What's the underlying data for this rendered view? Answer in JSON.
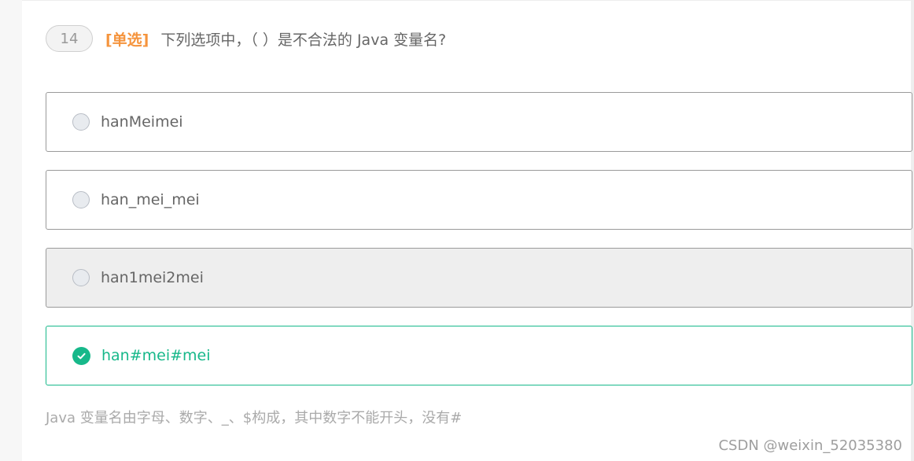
{
  "question": {
    "number": "14",
    "type": "[单选]",
    "text": "下列选项中，（ ）是不合法的 Java 变量名?"
  },
  "options": [
    {
      "label": "hanMeimei",
      "state": "unselected"
    },
    {
      "label": "han_mei_mei",
      "state": "unselected"
    },
    {
      "label": "han1mei2mei",
      "state": "hover"
    },
    {
      "label": "han#mei#mei",
      "state": "correct"
    }
  ],
  "explanation": "Java 变量名由字母、数字、_、$构成，其中数字不能开头，没有#",
  "watermark": "CSDN @weixin_52035380",
  "colors": {
    "accent_green": "#17b88a",
    "type_orange": "#f5943d",
    "text_gray": "#666666",
    "hover_bg": "#eeeeee"
  },
  "icons": {
    "correct": "check-circle-icon",
    "unselected": "radio-circle-icon"
  }
}
